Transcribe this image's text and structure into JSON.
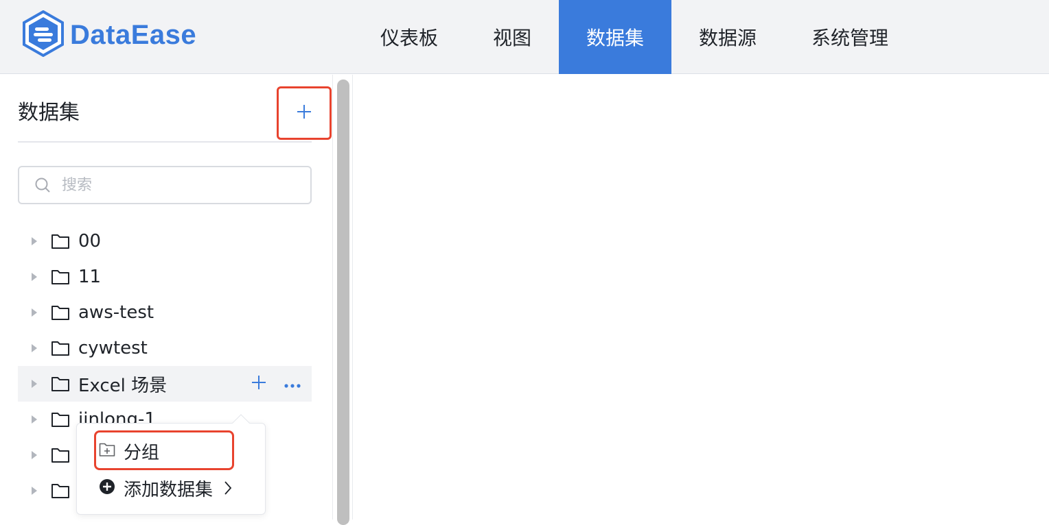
{
  "app": {
    "logo_text": "DataEase",
    "brand_color": "#3a7bdc",
    "highlight_color": "#e8432e"
  },
  "nav": {
    "items": [
      {
        "label": "仪表板",
        "active": false
      },
      {
        "label": "视图",
        "active": false
      },
      {
        "label": "数据集",
        "active": true
      },
      {
        "label": "数据源",
        "active": false
      },
      {
        "label": "系统管理",
        "active": false
      }
    ]
  },
  "sidebar": {
    "title": "数据集",
    "add_icon": "plus-icon",
    "search": {
      "placeholder": "搜索",
      "value": ""
    },
    "tree": [
      {
        "label": "00"
      },
      {
        "label": "11"
      },
      {
        "label": "aws-test"
      },
      {
        "label": "cywtest"
      },
      {
        "label": "Excel 场景"
      },
      {
        "label": "jinlong-1"
      },
      {
        "label": ""
      },
      {
        "label": ""
      }
    ]
  },
  "popover": {
    "items": [
      {
        "label": "分组",
        "icon": "folder-add-icon"
      },
      {
        "label": "添加数据集",
        "icon": "plus-circle-icon"
      }
    ]
  }
}
